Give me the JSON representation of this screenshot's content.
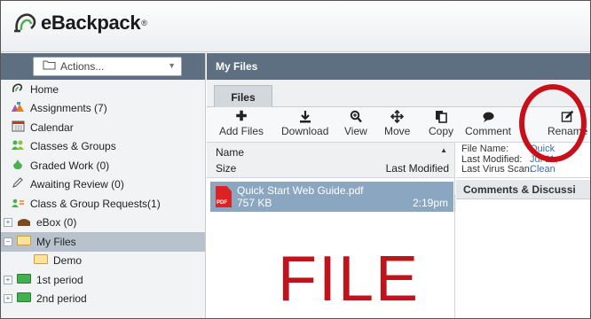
{
  "brand": {
    "name": "eBackpack",
    "reg": "®"
  },
  "sidebar": {
    "actions_label": "Actions...",
    "items": [
      {
        "label": "Home",
        "icon": "home-icon"
      },
      {
        "label": "Assignments (7)",
        "icon": "assignments-icon"
      },
      {
        "label": "Calendar",
        "icon": "calendar-icon"
      },
      {
        "label": "Classes & Groups",
        "icon": "groups-icon"
      },
      {
        "label": "Graded Work (0)",
        "icon": "graded-icon"
      },
      {
        "label": "Awaiting Review (0)",
        "icon": "pencil-icon"
      },
      {
        "label": "Class & Group Requests(1)",
        "icon": "requests-icon"
      },
      {
        "label": "eBox (0)",
        "icon": "ebox-icon"
      },
      {
        "label": "My Files",
        "icon": "folder-icon"
      },
      {
        "label": "Demo",
        "icon": "folder-icon"
      },
      {
        "label": "1st period",
        "icon": "green-folder-icon"
      },
      {
        "label": "2nd period",
        "icon": "green-folder-icon"
      }
    ]
  },
  "main": {
    "header": "My Files",
    "tab": "Files",
    "toolbar": [
      {
        "label": "Add Files",
        "icon": "plus-icon"
      },
      {
        "label": "Download",
        "icon": "download-icon"
      },
      {
        "label": "View",
        "icon": "zoom-icon"
      },
      {
        "label": "Move",
        "icon": "move-icon"
      },
      {
        "label": "Copy",
        "icon": "copy-icon"
      },
      {
        "label": "Comment",
        "icon": "comment-icon"
      },
      {
        "label": "Rename",
        "icon": "rename-icon"
      }
    ],
    "list": {
      "col_name": "Name",
      "col_size": "Size",
      "col_modified": "Last Modified",
      "files": [
        {
          "name": "Quick Start Web Guide.pdf",
          "size": "757 KB",
          "modified": "2:19pm",
          "badge": "PDF"
        }
      ]
    },
    "detail": {
      "file_name_label": "File Name:",
      "file_name_value": "Quick",
      "last_modified_label": "Last Modified:",
      "last_modified_value": "Jul 11,",
      "virus_label": "Last Virus Scan:",
      "virus_value": "Clean",
      "comments_header": "Comments & Discussi"
    }
  },
  "overlay": {
    "text": "FILE"
  },
  "colors": {
    "header_bg": "#5d6f80",
    "selected_row": "#8aa6c1",
    "annotation_red": "#c0141c"
  }
}
